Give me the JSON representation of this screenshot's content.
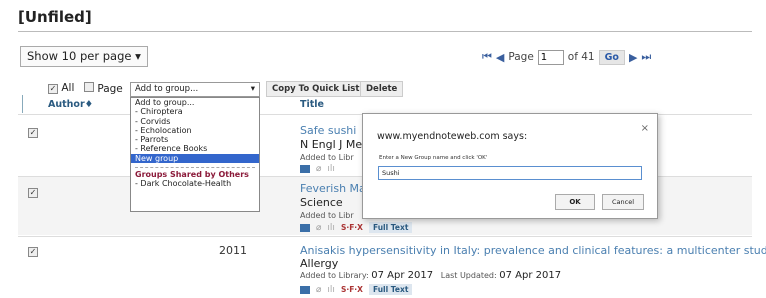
{
  "folder_title": "[Unfiled]",
  "per_page": "Show 10 per page",
  "pager": {
    "page_label": "Page",
    "page_value": "1",
    "of_label": "of 41",
    "go_label": "Go"
  },
  "toolbar": {
    "all_label": "All",
    "page_label": "Page",
    "group_select": "Add to group...",
    "copy_label": "Copy To Quick List",
    "delete_label": "Delete"
  },
  "dropdown": {
    "items": [
      "Add to group...",
      "- Chiroptera",
      "- Corvids",
      "- Echolocation",
      "- Parrots",
      "- Reference Books",
      "New group"
    ],
    "selected": "New group",
    "shared_header": "Groups Shared by Others",
    "shared_items": [
      "- Dark Chocolate-Health"
    ]
  },
  "columns": {
    "author": "Author",
    "title": "Title"
  },
  "rows": [
    {
      "year": "",
      "title": "Safe sushi",
      "journal": "N Engl J Me",
      "added": "Added to Libr"
    },
    {
      "year": "",
      "title": "Feverish Ma",
      "journal": "Science",
      "added": "Added to Libr"
    },
    {
      "year": "2011",
      "title": "Anisakis hypersensitivity in Italy: prevalence and clinical features: a multicenter study",
      "journal": "Allergy",
      "added_label": "Added to Library:",
      "added_date": "07 Apr 2017",
      "updated_label": "Last Updated:",
      "updated_date": "07 Apr 2017"
    }
  ],
  "icons": {
    "sfx": "S·F·X",
    "fulltext": "Full Text"
  },
  "dialog": {
    "title": "www.myendnoteweb.com says:",
    "message": "Enter a New Group name and click 'OK'",
    "input_value": "Sushi",
    "ok_label": "OK",
    "cancel_label": "Cancel",
    "close": "×"
  }
}
